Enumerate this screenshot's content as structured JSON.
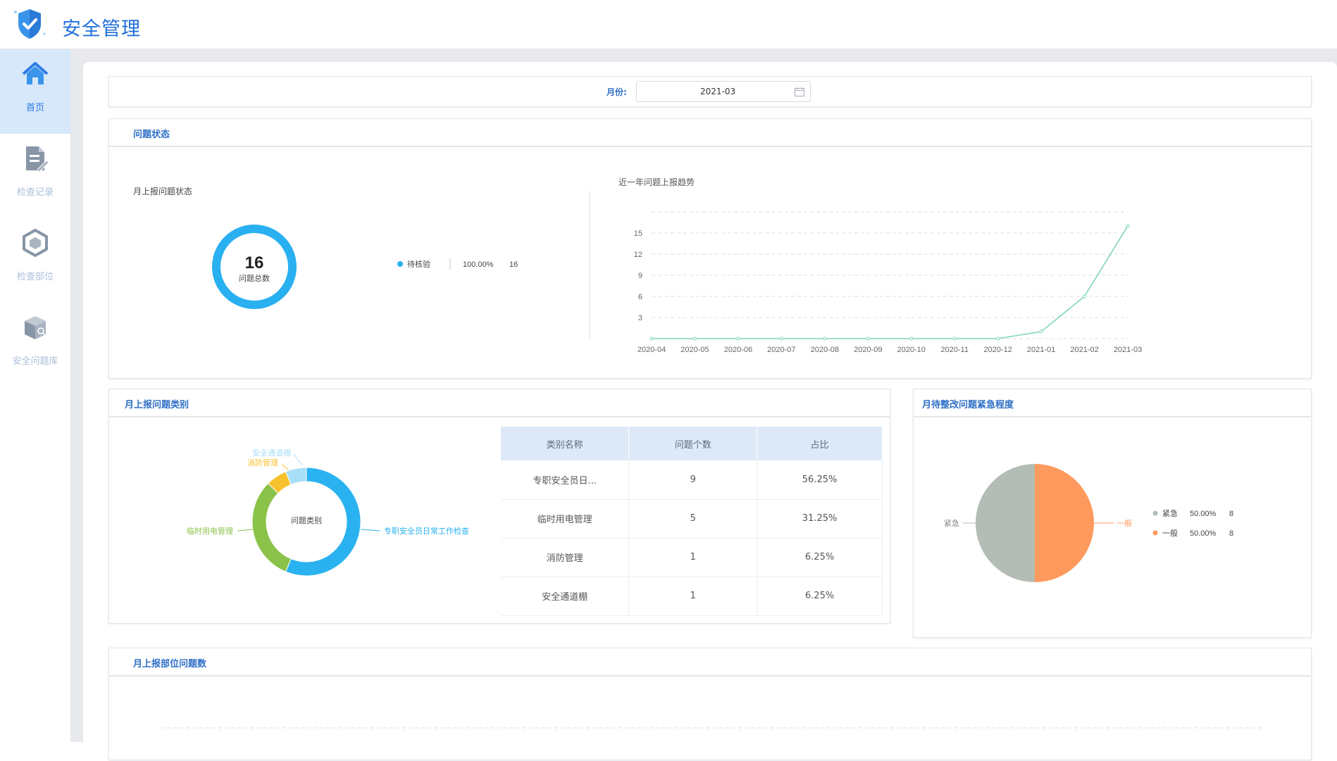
{
  "app": {
    "title": "安全管理"
  },
  "sidebar": {
    "items": [
      {
        "label": "首页",
        "icon": "home-icon",
        "active": true
      },
      {
        "label": "检查记录",
        "icon": "document-icon",
        "active": false
      },
      {
        "label": "检查部位",
        "icon": "hexagon-icon",
        "active": false
      },
      {
        "label": "安全问题库",
        "icon": "box-icon",
        "active": false
      }
    ]
  },
  "filter": {
    "month_label": "月份:",
    "month_value": "2021-03"
  },
  "status_card": {
    "title": "问题状态",
    "monthly_title": "月上报问题状态",
    "total": "16",
    "total_label": "问题总数",
    "legend": {
      "name": "待核验",
      "percent": "100.00%",
      "count": "16",
      "color": "#29b0f0"
    },
    "trend_title": "近一年问题上报趋势"
  },
  "category_card": {
    "title": "月上报问题类别",
    "donut_center": "问题类别",
    "columns": [
      "类别名称",
      "问题个数",
      "占比"
    ],
    "rows": [
      {
        "name": "专职安全员日...",
        "count": "9",
        "ratio": "56.25%"
      },
      {
        "name": "临时用电管理",
        "count": "5",
        "ratio": "31.25%"
      },
      {
        "name": "消防管理",
        "count": "1",
        "ratio": "6.25%"
      },
      {
        "name": "安全通道棚",
        "count": "1",
        "ratio": "6.25%"
      }
    ]
  },
  "urgency_card": {
    "title": "月待整改问题紧急程度",
    "legend": [
      {
        "name": "紧急",
        "percent": "50.00%",
        "count": "8",
        "color": "#b3bdb5"
      },
      {
        "name": "一般",
        "percent": "50.00%",
        "count": "8",
        "color": "#fe9a5d"
      }
    ]
  },
  "location_card": {
    "title": "月上报部位问题数"
  },
  "chart_data": [
    {
      "type": "pie",
      "name": "月上报问题状态",
      "categories": [
        "待核验"
      ],
      "values": [
        16
      ],
      "center_text": "16",
      "center_label": "问题总数"
    },
    {
      "type": "line",
      "title": "近一年问题上报趋势",
      "categories": [
        "2020-04",
        "2020-05",
        "2020-06",
        "2020-07",
        "2020-08",
        "2020-09",
        "2020-10",
        "2020-11",
        "2020-12",
        "2021-01",
        "2021-02",
        "2021-03"
      ],
      "values": [
        0,
        0,
        0,
        0,
        0,
        0,
        0,
        0,
        0,
        1,
        6,
        16
      ],
      "yticks": [
        3,
        6,
        9,
        12,
        15
      ],
      "ylim": [
        0,
        18
      ],
      "grid": true,
      "color": "#7fd3c0"
    },
    {
      "type": "pie",
      "title": "问题类别",
      "categories": [
        "专职安全员日常工作检查",
        "临时用电管理",
        "消防管理",
        "安全通道棚"
      ],
      "values": [
        9,
        5,
        1,
        1
      ],
      "colors": [
        "#2ab2f0",
        "#8bc34a",
        "#f7c12e",
        "#a8def7"
      ]
    },
    {
      "type": "pie",
      "title": "月待整改问题紧急程度",
      "categories": [
        "紧急",
        "一般"
      ],
      "values": [
        8,
        8
      ],
      "colors": [
        "#b3bdb5",
        "#fe9a5d"
      ]
    }
  ]
}
